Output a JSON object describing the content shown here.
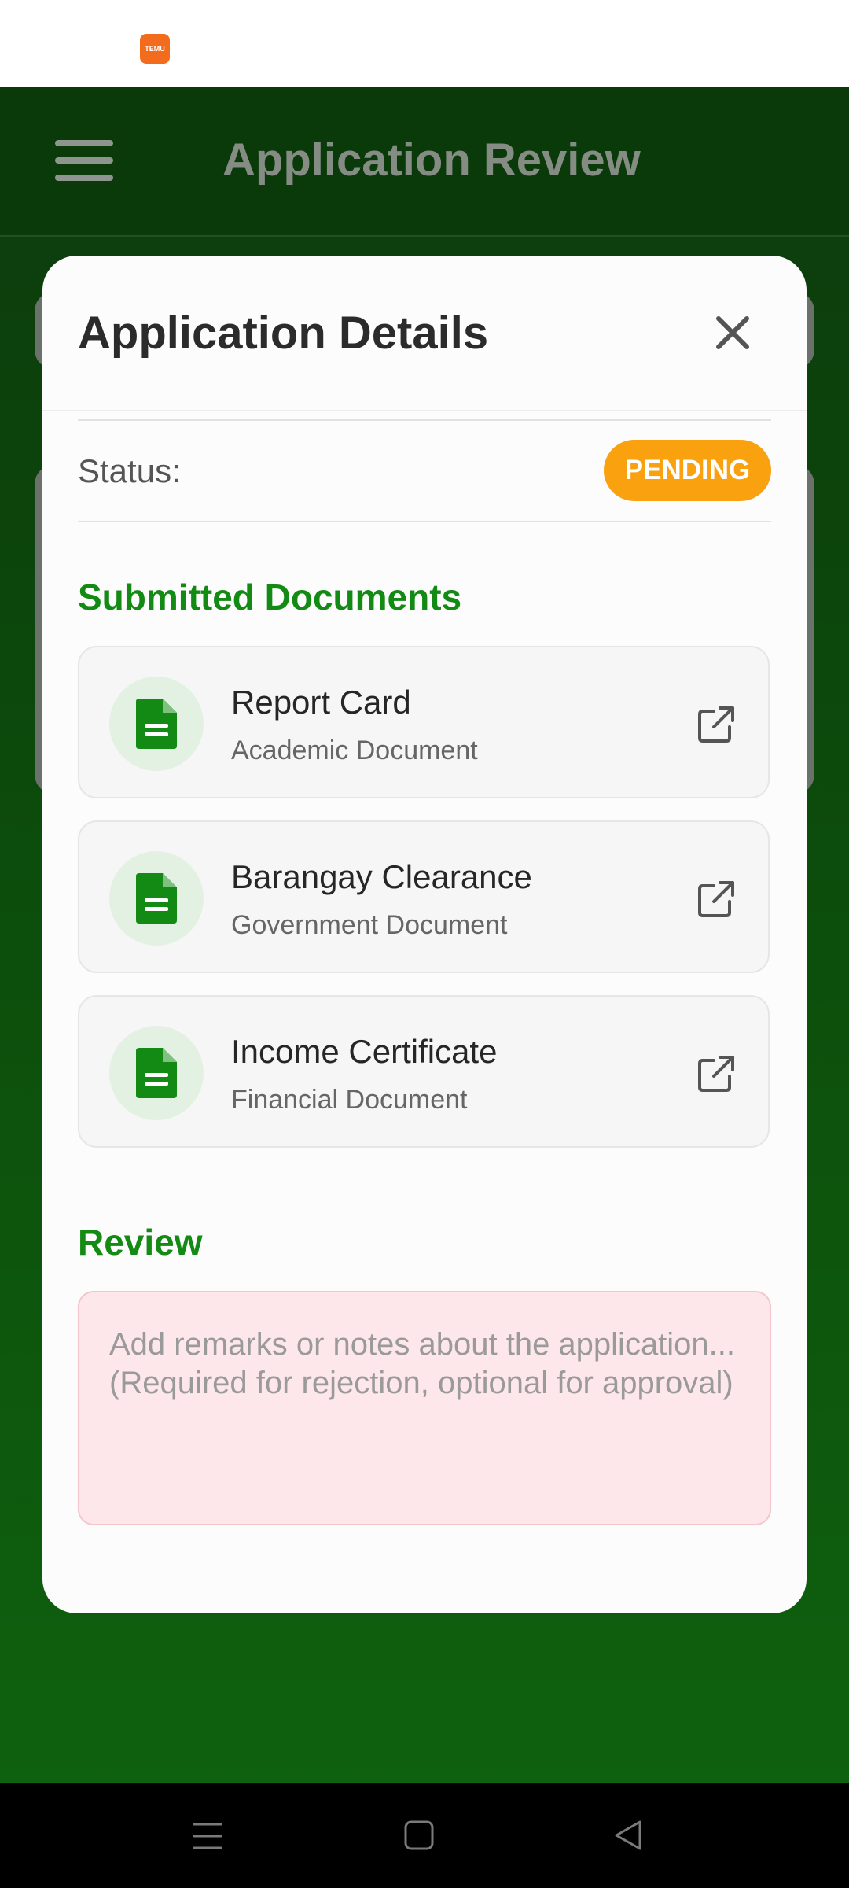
{
  "status_bar": {
    "notification_icon": "temu-app-icon",
    "notification_icon_text": "TEMU"
  },
  "app_bar": {
    "title": "Application Review",
    "menu_icon": "hamburger-menu-icon"
  },
  "modal": {
    "title": "Application Details",
    "close_icon": "close-icon",
    "status": {
      "label": "Status:",
      "value": "PENDING",
      "color": "#f9a10f"
    },
    "documents_section": {
      "title": "Submitted Documents",
      "items": [
        {
          "name": "Report Card",
          "type": "Academic Document"
        },
        {
          "name": "Barangay Clearance",
          "type": "Government Document"
        },
        {
          "name": "Income Certificate",
          "type": "Financial Document"
        }
      ]
    },
    "review_section": {
      "title": "Review",
      "remarks_placeholder": "Add remarks or notes about the application...\n(Required for rejection, optional for approval)"
    }
  },
  "colors": {
    "accent_green": "#138a13",
    "background_green": "#0c4a0c",
    "remarks_bg": "#fde7ea"
  },
  "nav_bar": {
    "buttons": [
      "recent-apps-icon",
      "home-icon",
      "back-icon"
    ]
  }
}
